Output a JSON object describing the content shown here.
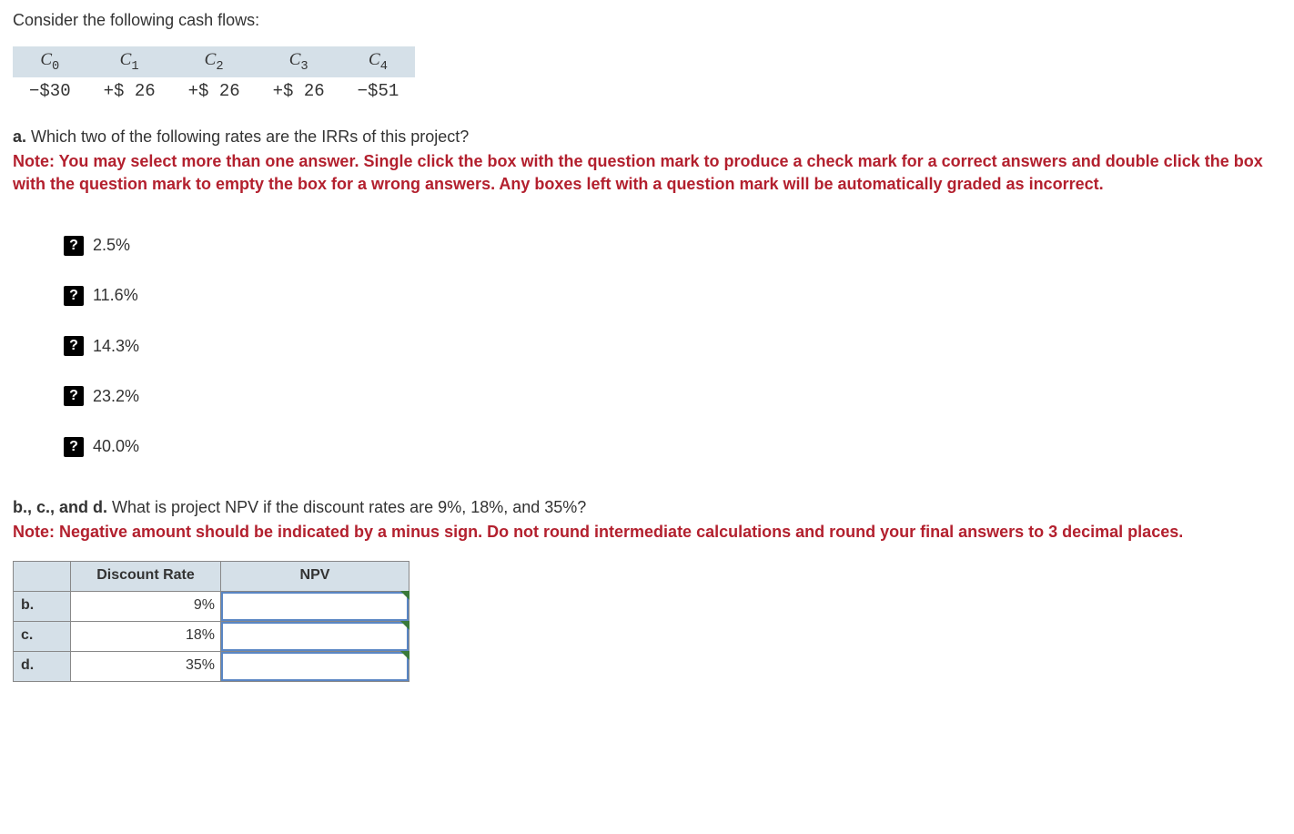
{
  "intro": "Consider the following cash flows:",
  "cashflow": {
    "headers": [
      {
        "base": "C",
        "sub": "0"
      },
      {
        "base": "C",
        "sub": "1"
      },
      {
        "base": "C",
        "sub": "2"
      },
      {
        "base": "C",
        "sub": "3"
      },
      {
        "base": "C",
        "sub": "4"
      }
    ],
    "values": [
      "−$30",
      "+$ 26",
      "+$ 26",
      "+$ 26",
      "−$51"
    ]
  },
  "part_a": {
    "label": "a.",
    "question": "Which two of the following rates are the IRRs of this project?",
    "note": "Note: You may select more than one answer. Single click the box with the question mark to produce a check mark for a correct answers and double click the box with the question mark to empty the box for a wrong answers. Any boxes left with a question mark will be automatically graded as incorrect.",
    "box_glyph": "?",
    "options": [
      "2.5%",
      "11.6%",
      "14.3%",
      "23.2%",
      "40.0%"
    ]
  },
  "part_bcd": {
    "label": "b., c., and d.",
    "question": "What is project NPV if the discount rates are 9%, 18%, and 35%?",
    "note": "Note: Negative amount should be indicated by a minus sign. Do not round intermediate calculations and round your final answers to 3 decimal places.",
    "col_discount": "Discount Rate",
    "col_npv": "NPV",
    "rows": [
      {
        "label": "b.",
        "rate": "9%",
        "npv": ""
      },
      {
        "label": "c.",
        "rate": "18%",
        "npv": ""
      },
      {
        "label": "d.",
        "rate": "35%",
        "npv": ""
      }
    ]
  }
}
